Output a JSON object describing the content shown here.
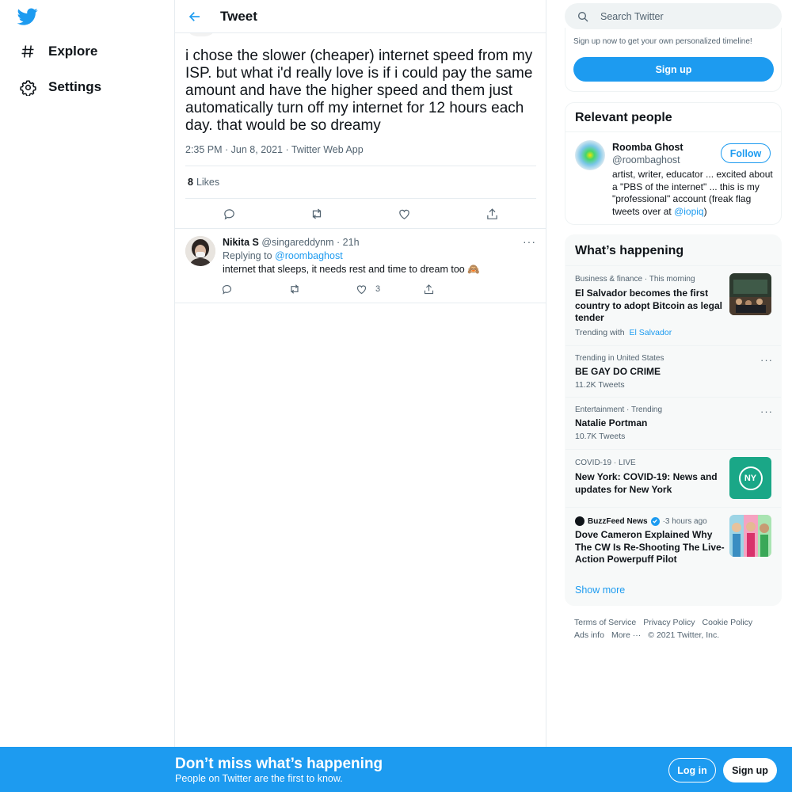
{
  "colors": {
    "accent": "#1d9bf0",
    "text": "#0f1419",
    "muted": "#536471",
    "border": "#e6ecf0"
  },
  "nav": {
    "logo_icon": "twitter-bird-icon",
    "items": [
      {
        "label": "Explore",
        "icon": "hashtag-icon"
      },
      {
        "label": "Settings",
        "icon": "gear-icon"
      }
    ]
  },
  "header": {
    "title": "Tweet"
  },
  "tweet": {
    "text": "i chose the slower (cheaper) internet speed from my ISP. but what i'd really love is if i could pay the same amount and have the higher speed and them just automatically turn off my internet for 12 hours each day. that would be so dreamy",
    "time": "2:35 PM",
    "date": "Jun 8, 2021",
    "source": "Twitter Web App",
    "likes_count": "8",
    "likes_label": "Likes"
  },
  "reply": {
    "name": "Nikita S",
    "handle": "@singareddynm",
    "time": "21h",
    "replying_prefix": "Replying to",
    "replying_to": "@roombaghost",
    "text": "internet that sleeps, it needs rest and time to dream too 🙈",
    "like_count": "3"
  },
  "search": {
    "placeholder": "Search Twitter"
  },
  "signup_card": {
    "text": "Sign up now to get your own personalized timeline!",
    "button": "Sign up"
  },
  "relevant": {
    "title": "Relevant people",
    "name": "Roomba Ghost",
    "handle": "@roombaghost",
    "follow": "Follow",
    "bio": "artist, writer, educator ... excited about a \"PBS of the internet\" ... this is my \"professional\" account (freak flag tweets over at ",
    "bio_link": "@iopiq",
    "bio_end": ")"
  },
  "happening": {
    "title": "What’s happening",
    "trends": [
      {
        "meta": "Business & finance · This morning",
        "title": "El Salvador becomes the first country to adopt Bitcoin as legal tender",
        "sub_prefix": "Trending with",
        "sub_link": "El Salvador"
      },
      {
        "meta": "Trending in United States",
        "title": "BE GAY DO CRIME",
        "sub": "11.2K Tweets"
      },
      {
        "meta": "Entertainment · Trending",
        "title": "Natalie Portman",
        "sub": "10.7K Tweets"
      },
      {
        "meta": "COVID-19 · LIVE",
        "title": "New York: COVID-19: News and updates for New York",
        "thumb_text": "NY"
      },
      {
        "source": "BuzzFeed News",
        "time": "3 hours ago",
        "title": "Dove Cameron Explained Why The CW Is Re-Shooting The Live-Action Powerpuff Pilot"
      }
    ],
    "show_more": "Show more"
  },
  "footer": {
    "links": [
      "Terms of Service",
      "Privacy Policy",
      "Cookie Policy",
      "Ads info",
      "More ···",
      "© 2021 Twitter, Inc."
    ]
  },
  "bottom_bar": {
    "title": "Don’t miss what’s happening",
    "subtitle": "People on Twitter are the first to know.",
    "login": "Log in",
    "signup": "Sign up"
  }
}
